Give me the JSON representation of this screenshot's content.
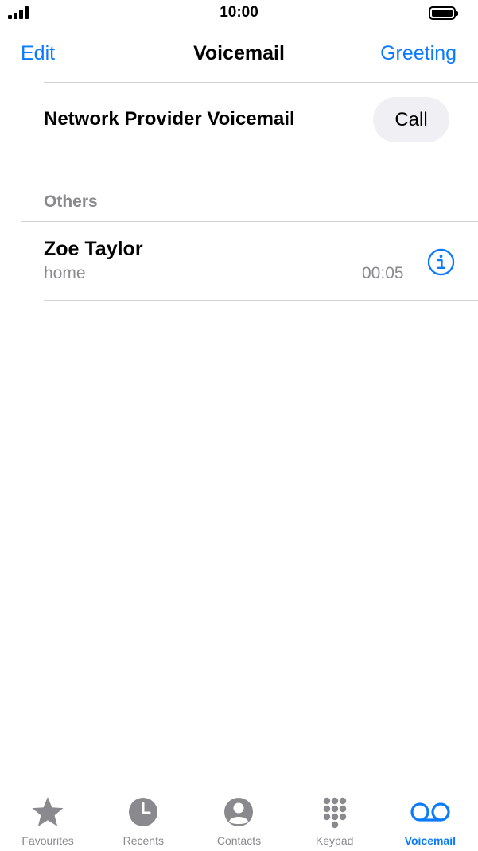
{
  "status_bar": {
    "time": "10:00"
  },
  "nav": {
    "edit_label": "Edit",
    "title": "Voicemail",
    "greeting_label": "Greeting"
  },
  "provider": {
    "label": "Network Provider Voicemail",
    "call_label": "Call"
  },
  "section": {
    "others_label": "Others"
  },
  "voicemails": [
    {
      "name": "Zoe Taylor",
      "type": "home",
      "duration": "00:05"
    }
  ],
  "tabs": [
    {
      "label": "Favourites",
      "icon": "star-icon",
      "active": false
    },
    {
      "label": "Recents",
      "icon": "clock-icon",
      "active": false
    },
    {
      "label": "Contacts",
      "icon": "person-icon",
      "active": false
    },
    {
      "label": "Keypad",
      "icon": "keypad-icon",
      "active": false
    },
    {
      "label": "Voicemail",
      "icon": "voicemail-icon",
      "active": true
    }
  ],
  "colors": {
    "accent": "#0a7aff",
    "inactive": "#8a8a8e",
    "separator": "#d4d4d6",
    "button_bg": "#efeff4"
  }
}
